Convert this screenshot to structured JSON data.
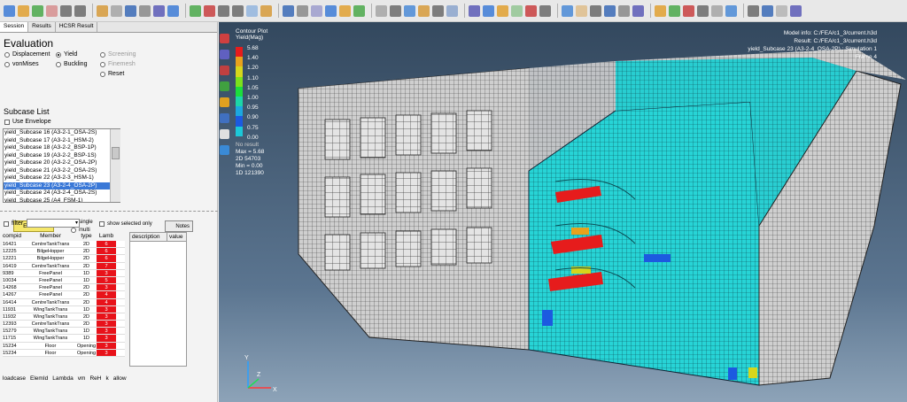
{
  "toolbar": {
    "icons": [
      "open-icon",
      "save-icon",
      "import-icon",
      "export-icon",
      "undo-icon",
      "redo-icon",
      "select-icon",
      "rotate-icon",
      "pan-icon",
      "zoom-icon",
      "fit-icon",
      "view-icon"
    ]
  },
  "tabs": [
    "Session",
    "Results",
    "HCSR Result"
  ],
  "evaluation": {
    "title": "Evaluation",
    "col1": [
      "Displacement",
      "vonMises"
    ],
    "col2": [
      "Yield",
      "Buckling"
    ],
    "col3": [
      "Screening",
      "Finemesh",
      "Reset"
    ],
    "selected": "Yield"
  },
  "subcase": {
    "title": "Subcase List",
    "use_envelope": "Use Envelope",
    "items": [
      "yield_Subcase 16 (A3-2-1_OSA-2S)",
      "yield_Subcase 17 (A3-2-1_HSM-2)",
      "yield_Subcase 18 (A3-2-2_BSP-1P)",
      "yield_Subcase 19 (A3-2-2_BSP-1S)",
      "yield_Subcase 20 (A3-2-2_OSA-2P)",
      "yield_Subcase 21 (A3-2-2_OSA-2S)",
      "yield_Subcase 22 (A3-2-3_HSM-1)",
      "yield_Subcase 23 (A3-2-4_OSA-2P)",
      "yield_Subcase 24 (A3-2-4_OSA-2S)",
      "yield_Subcase 25 (A4_FSM-1)"
    ],
    "selected_index": 7
  },
  "element": {
    "button": "Element",
    "single": "single",
    "multi": "multi",
    "show_selected": "show selected only",
    "notes": "Notes",
    "filter": "filter"
  },
  "table": {
    "headers": [
      "compid",
      "Member",
      "type",
      "Lamb"
    ],
    "rows": [
      [
        "16421",
        "CentreTankTrans",
        "2D",
        "6"
      ],
      [
        "12225",
        "BilgeHopper",
        "2D",
        "6"
      ],
      [
        "12221",
        "BilgeHopper",
        "2D",
        "6"
      ],
      [
        "16419",
        "CentreTankTrans",
        "2D",
        "7"
      ],
      [
        "9389",
        "FreePanel",
        "1D",
        "3"
      ],
      [
        "10034",
        "FreePanel",
        "1D",
        "5"
      ],
      [
        "14268",
        "FreePanel",
        "2D",
        "3"
      ],
      [
        "14267",
        "FreePanel",
        "2D",
        "4"
      ],
      [
        "16414",
        "CentreTankTrans",
        "2D",
        "4"
      ],
      [
        "11931",
        "WingTankTrans",
        "1D",
        "3"
      ],
      [
        "11932",
        "WingTankTrans",
        "2D",
        "3"
      ],
      [
        "12393",
        "CentreTankTrans",
        "2D",
        "3"
      ],
      [
        "15279",
        "WingTankTrans",
        "1D",
        "3"
      ],
      [
        "11715",
        "WingTankTrans",
        "1D",
        "3"
      ],
      [
        "15234",
        "Floor",
        "Opening",
        "3"
      ],
      [
        "15234",
        "Floor",
        "Opening",
        "3"
      ]
    ]
  },
  "desc_table": {
    "headers": [
      "description",
      "value"
    ]
  },
  "bottom_headers": [
    "loadcase",
    "ElemId",
    "Lambda",
    "vm",
    "ReH",
    "k",
    "allow"
  ],
  "legend": {
    "title": "Contour Plot",
    "subtitle": "Yield(Mag)",
    "labels": [
      "5.68",
      "1.40",
      "1.20",
      "1.10",
      "1.05",
      "1.00",
      "0.95",
      "0.90",
      "0.75",
      "0.00"
    ],
    "colors": [
      "#e61c1c",
      "#e8a21c",
      "#d6d61c",
      "#7ce11c",
      "#1cde3c",
      "#1cd6a8",
      "#1ca8e0",
      "#1c5ae0",
      "#1cc8d8"
    ],
    "no_result": "No result",
    "max": "Max = 5.68",
    "elem": "2D 54703",
    "min": "Min = 0.00",
    "elem2": "1D 121390"
  },
  "model_info": {
    "model": "Model info: C:/FEA/c1_3/current.h3d",
    "result": "Result: C:/FEA/c1_3/current.h3d",
    "subcase": "yield_Subcase 23 (A3-2-4_OSA-2P) : Simulation 1",
    "frame": "Frame 4"
  },
  "axes": {
    "y": "Y",
    "z": "Z",
    "x": "X"
  }
}
